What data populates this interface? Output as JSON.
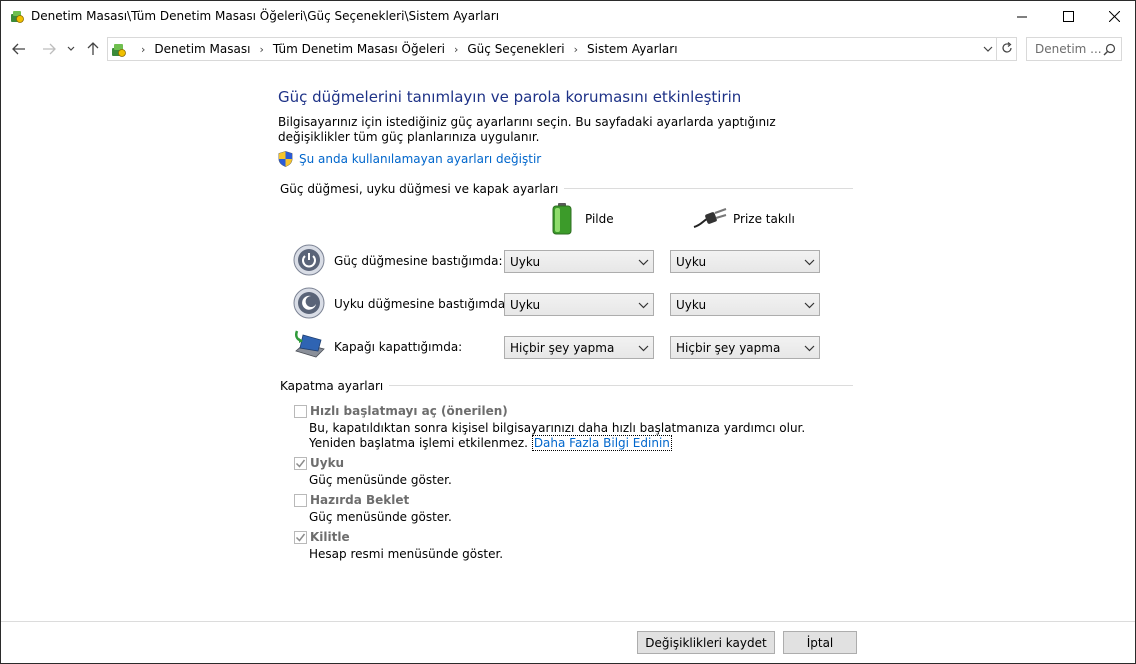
{
  "window": {
    "title": "Denetim Masası\\Tüm Denetim Masası Öğeleri\\Güç Seçenekleri\\Sistem Ayarları"
  },
  "address": {
    "crumbs": [
      "Denetim Masası",
      "Tüm Denetim Masası Öğeleri",
      "Güç Seçenekleri",
      "Sistem Ayarları"
    ],
    "search_placeholder": "Denetim ..."
  },
  "main": {
    "heading": "Güç düğmelerini tanımlayın ve parola korumasını etkinleştirin",
    "description": "Bilgisayarınız için istediğiniz güç ayarlarını seçin. Bu sayfadaki ayarlarda yaptığınız değişiklikler tüm güç planlarınıza uygulanır.",
    "change_unavailable_link": "Şu anda kullanılamayan ayarları değiştir"
  },
  "power_settings": {
    "group_title": "Güç düğmesi, uyku düğmesi ve kapak ayarları",
    "col_battery": "Pilde",
    "col_plugged": "Prize takılı",
    "rows": [
      {
        "label": "Güç düğmesine bastığımda:",
        "battery": "Uyku",
        "plugged": "Uyku",
        "icon": "power-button-icon"
      },
      {
        "label": "Uyku düğmesine bastığımda:",
        "battery": "Uyku",
        "plugged": "Uyku",
        "icon": "sleep-button-icon"
      },
      {
        "label": "Kapağı kapattığımda:",
        "battery": "Hiçbir şey yapma",
        "plugged": "Hiçbir şey yapma",
        "icon": "laptop-lid-icon"
      }
    ]
  },
  "shutdown_settings": {
    "group_title": "Kapatma ayarları",
    "items": [
      {
        "label": "Hızlı başlatmayı aç (önerilen)",
        "checked": false,
        "desc": "Bu, kapatıldıktan sonra kişisel bilgisayarınızı daha hızlı başlatmanıza yardımcı olur. Yeniden başlatma işlemi etkilenmez.",
        "link": "Daha Fazla Bilgi Edinin"
      },
      {
        "label": "Uyku",
        "checked": true,
        "desc": "Güç menüsünde göster."
      },
      {
        "label": "Hazırda Beklet",
        "checked": false,
        "desc": "Güç menüsünde göster."
      },
      {
        "label": "Kilitle",
        "checked": true,
        "desc": "Hesap resmi menüsünde göster."
      }
    ]
  },
  "footer": {
    "save_label": "Değişiklikleri kaydet",
    "cancel_label": "İptal"
  },
  "colors": {
    "heading": "#1e3287",
    "link": "#0066cc",
    "disabled_text": "#6d6d6d"
  }
}
